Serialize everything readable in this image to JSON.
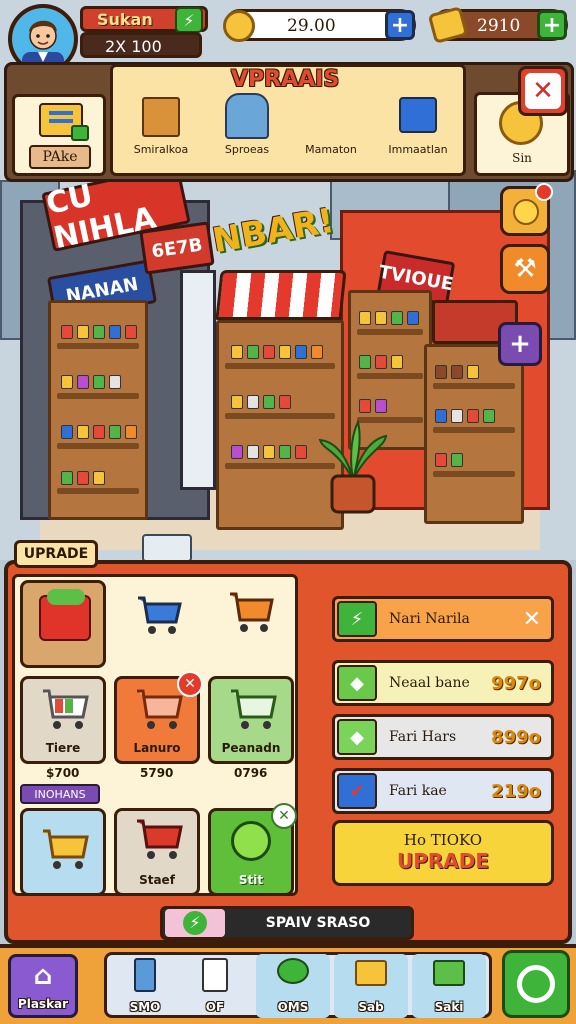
{
  "player": {
    "name": "Sukan",
    "level_text": "2X 100",
    "boost_icon": "bolt-icon"
  },
  "currency": {
    "coins": "29.00",
    "gold": "2910"
  },
  "category_panel": {
    "title": "VPRAAIS",
    "left_tab": "PAke",
    "items": [
      {
        "label": "Smiralkoa",
        "icon": "crate-icon"
      },
      {
        "label": "Sproeas",
        "icon": "clothes-icon"
      },
      {
        "label": "Mamaton",
        "icon": "cart-icon"
      },
      {
        "label": "Immaatlan",
        "icon": "blue-cart-icon"
      }
    ],
    "right_tab": "Sin",
    "close_label": "✕"
  },
  "store_signs": {
    "main": "CU NIHLA",
    "left_shelf": "NANAN",
    "center": "6E7B",
    "colorful": "NBAR!",
    "right": "TVIOUE"
  },
  "upgrade_panel": {
    "tab": "UPRADE",
    "section_label": "INOHANS",
    "tiles": [
      {
        "label": "",
        "price": "",
        "color": "#d9a76b"
      },
      {
        "label": "",
        "price": "",
        "color": "#fdf3d6"
      },
      {
        "label": "",
        "price": "",
        "color": "#fdf3d6"
      },
      {
        "label": "Tiere",
        "price": "$700",
        "color": "#e2d8c8"
      },
      {
        "label": "Lanuro",
        "price": "5790",
        "color": "#f07a3a"
      },
      {
        "label": "Peanadn",
        "price": "0796",
        "color": "#a7d98a"
      },
      {
        "label": "",
        "price": "",
        "color": "#b6dcef"
      },
      {
        "label": "Staef",
        "price": "",
        "color": "#e2d8c8"
      },
      {
        "label": "Stit",
        "price": "",
        "color": "#5fbf3a"
      }
    ],
    "rows": [
      {
        "name": "Nari Narila",
        "value": "✕",
        "icon": "lightning-icon",
        "bg": "#f8a24a"
      },
      {
        "name": "Neaal bane",
        "value": "997o",
        "icon": "tag-icon",
        "bg": "#f6f1b6"
      },
      {
        "name": "Fari Hars",
        "value": "899o",
        "icon": "tag-icon",
        "bg": "#e7e7e7"
      },
      {
        "name": "Fari kae",
        "value": "219o",
        "icon": "check-icon",
        "bg": "#dfe7f3"
      }
    ],
    "big_button_line1": "Ho TIOKO",
    "big_button_line2": "UPRADE",
    "spin_button": "SPAIV SRASO"
  },
  "nav": {
    "items": [
      {
        "label": "Plaskar"
      },
      {
        "label": "SMO"
      },
      {
        "label": "OF"
      },
      {
        "label": "OMS"
      },
      {
        "label": "Sab"
      },
      {
        "label": "Saki"
      }
    ]
  },
  "colors": {
    "accent_red": "#d0402c",
    "accent_green": "#3fb43a",
    "accent_blue": "#2f6fd6",
    "panel_orange": "#e0552b"
  }
}
